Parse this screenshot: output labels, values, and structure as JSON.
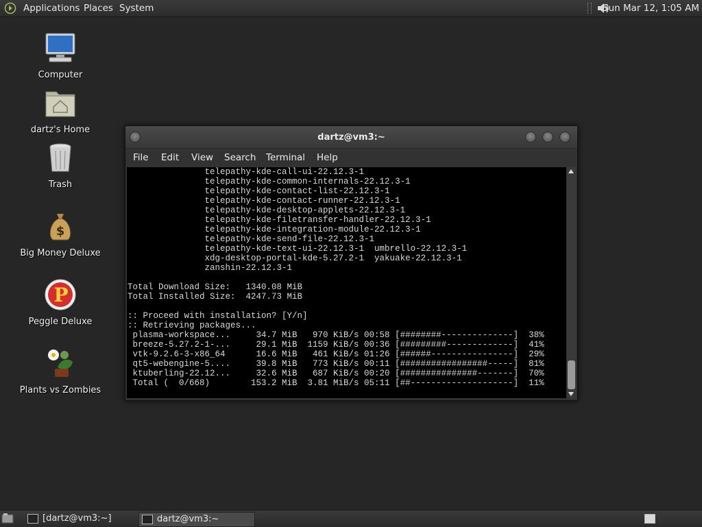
{
  "top_panel": {
    "menus": [
      "Applications",
      "Places",
      "System"
    ],
    "clock": "Sun Mar 12,  1:05 AM"
  },
  "desktop": {
    "icons": [
      {
        "label": "Computer",
        "icon": "computer-icon"
      },
      {
        "label": "dartz's Home",
        "icon": "home-folder-icon"
      },
      {
        "label": "Trash",
        "icon": "trash-icon"
      },
      {
        "label": "Big Money Deluxe",
        "icon": "money-bag-icon"
      },
      {
        "label": "Peggle Deluxe",
        "icon": "peggle-icon"
      },
      {
        "label": "Plants vs Zombies",
        "icon": "plants-vs-zombies-icon"
      }
    ]
  },
  "terminal": {
    "title": "dartz@vm3:~",
    "menu": [
      "File",
      "Edit",
      "View",
      "Search",
      "Terminal",
      "Help"
    ],
    "lines": [
      "               telepathy-kde-call-ui-22.12.3-1",
      "               telepathy-kde-common-internals-22.12.3-1",
      "               telepathy-kde-contact-list-22.12.3-1",
      "               telepathy-kde-contact-runner-22.12.3-1",
      "               telepathy-kde-desktop-applets-22.12.3-1",
      "               telepathy-kde-filetransfer-handler-22.12.3-1",
      "               telepathy-kde-integration-module-22.12.3-1",
      "               telepathy-kde-send-file-22.12.3-1",
      "               telepathy-kde-text-ui-22.12.3-1  umbrello-22.12.3-1",
      "               xdg-desktop-portal-kde-5.27.2-1  yakuake-22.12.3-1",
      "               zanshin-22.12.3-1",
      "",
      "Total Download Size:   1340.08 MiB",
      "Total Installed Size:  4247.73 MiB",
      "",
      ":: Proceed with installation? [Y/n]",
      ":: Retrieving packages...",
      " plasma-workspace...     34.7 MiB   970 KiB/s 00:58 [########--------------]  38%",
      " breeze-5.27.2-1-...     29.1 MiB  1159 KiB/s 00:36 [#########-------------]  41%",
      " vtk-9.2.6-3-x86_64      16.6 MiB   461 KiB/s 01:26 [######----------------]  29%",
      " qt5-webengine-5....     39.8 MiB   773 KiB/s 00:11 [#################-----]  81%",
      " ktuberling-22.12...     32.6 MiB   687 KiB/s 00:20 [###############-------]  70%",
      " Total (  0/668)        153.2 MiB  3.81 MiB/s 05:11 [##--------------------]  11%"
    ]
  },
  "taskbar": {
    "tasks": [
      "[dartz@vm3:~]",
      "dartz@vm3:~"
    ]
  },
  "colors": {
    "desktop_bg": "#262626",
    "terminal_bg": "#000000",
    "terminal_fg": "#d8d8d8"
  }
}
